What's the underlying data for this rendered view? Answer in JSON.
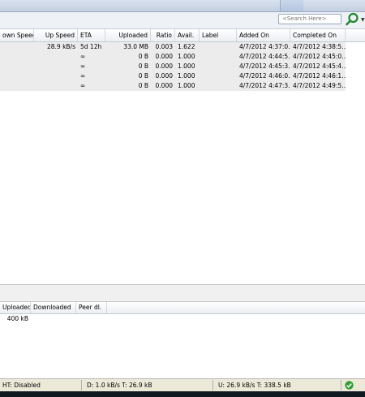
{
  "search": {
    "placeholder": "<Search Here>"
  },
  "colors": {
    "row_bg": "#ececec",
    "status_ok": "#2e9e2e",
    "search_icon": "#1f8a2e"
  },
  "icons": {
    "search": "search-icon",
    "search_dropdown": "chevron-down-icon",
    "status": "check-circle-icon"
  },
  "torrent_table": {
    "headers": [
      "own Speed",
      "Up Speed",
      "ETA",
      "Uploaded",
      "Ratio",
      "Avail.",
      "Label",
      "Added On",
      "Completed On"
    ],
    "rows": [
      [
        "",
        "28.9 kB/s",
        "5d 12h",
        "33.0 MB",
        "0.003",
        "1.622",
        "",
        "4/7/2012 4:37:0…",
        "4/7/2012 4:38:5…"
      ],
      [
        "",
        "",
        "∞",
        "0 B",
        "0.000",
        "1.000",
        "",
        "4/7/2012 4:44:5…",
        "4/7/2012 4:45:0…"
      ],
      [
        "",
        "",
        "∞",
        "0 B",
        "0.000",
        "1.000",
        "",
        "4/7/2012 4:45:3…",
        "4/7/2012 4:45:4…"
      ],
      [
        "",
        "",
        "∞",
        "0 B",
        "0.000",
        "1.000",
        "",
        "4/7/2012 4:46:0…",
        "4/7/2012 4:46:1…"
      ],
      [
        "",
        "",
        "∞",
        "0 B",
        "0.000",
        "1.000",
        "",
        "4/7/2012 4:47:3…",
        "4/7/2012 4:49:5…"
      ]
    ]
  },
  "peers_table": {
    "headers": [
      "Uploaded",
      "Downloaded",
      "Peer dl."
    ],
    "rows": [
      [
        "400 kB",
        "",
        ""
      ]
    ]
  },
  "status_bar": {
    "dht": "HT: Disabled",
    "download": "D: 1.0 kB/s T: 26.9 kB",
    "upload": "U: 26.9 kB/s T: 338.5 kB"
  }
}
